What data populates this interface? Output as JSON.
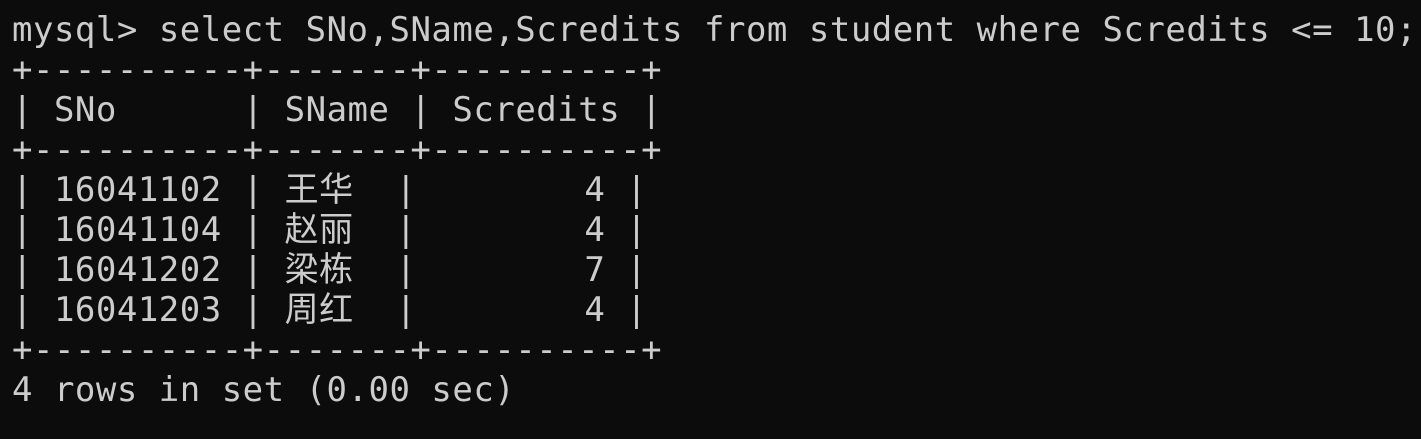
{
  "prompt": "mysql>",
  "command": "select SNo,SName,Scredits from student where Scredits <= 10;",
  "separator": "+----------+-------+----------+",
  "table": {
    "columns": [
      "SNo",
      "SName",
      "Scredits"
    ],
    "rows": [
      {
        "SNo": "16041102",
        "SName": "王华",
        "Scredits": "4"
      },
      {
        "SNo": "16041104",
        "SName": "赵丽",
        "Scredits": "4"
      },
      {
        "SNo": "16041202",
        "SName": "梁栋",
        "Scredits": "7"
      },
      {
        "SNo": "16041203",
        "SName": "周红",
        "Scredits": "4"
      }
    ]
  },
  "result_summary": "4 rows in set (0.00 sec)"
}
